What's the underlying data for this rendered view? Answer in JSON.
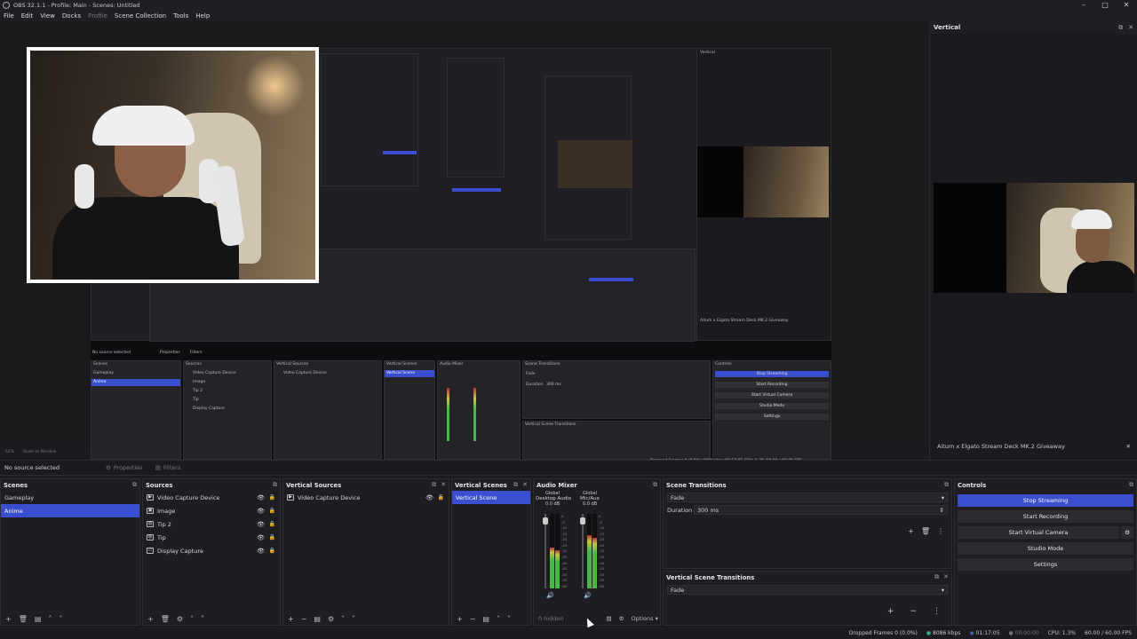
{
  "window": {
    "title": "OBS 32.1.1 - Profile: Main - Scenes: Untitled"
  },
  "menu": [
    "File",
    "Edit",
    "View",
    "Docks",
    "Profile",
    "Scene Collection",
    "Tools",
    "Help"
  ],
  "preview": {
    "nested": {
      "no_source": "No source selected",
      "properties": "Properties",
      "filters": "Filters",
      "scenes_title": "Scenes",
      "scenes": [
        "Gameplay",
        "Anime"
      ],
      "sources_title": "Sources",
      "sources": [
        "Video Capture Device",
        "Image",
        "Tip 2",
        "Tip",
        "Display Capture"
      ],
      "vsources_title": "Vertical Sources",
      "vsources": [
        "Video Capture Device"
      ],
      "vscenes_title": "Vertical Scenes",
      "vscenes": [
        "Vertical Scene"
      ],
      "mixer_title": "Audio Mixer",
      "transitions_title": "Scene Transitions",
      "transition": "Fade",
      "duration_label": "Duration",
      "duration": "300 ms",
      "vtransitions_title": "Vertical Scene Transitions",
      "controls_title": "Controls",
      "controls": [
        "Stop Streaming",
        "Start Recording",
        "Start Virtual Camera",
        "Studio Mode",
        "Settings"
      ],
      "vertical_title": "Vertical",
      "giveaway": "Aitum x Elgato Stream Deck MK.2 Giveaway",
      "status": "Dropped Frames 0 (0.0%)   8086 kbps   01:17:01   CPU: 1.3%   60.00 / 60.00 FPS"
    }
  },
  "zoom": {
    "value": "61%",
    "mode": "Scale to Window"
  },
  "vertical_dock": {
    "title": "Vertical",
    "giveaway": "Aitum x Elgato Stream Deck MK.2 Giveaway"
  },
  "props_bar": {
    "no_source": "No source selected",
    "properties": "Properties",
    "filters": "Filters"
  },
  "scenes": {
    "title": "Scenes",
    "items": [
      {
        "label": "Gameplay"
      },
      {
        "label": "Anime"
      }
    ]
  },
  "sources": {
    "title": "Sources",
    "items": [
      {
        "label": "Video Capture Device"
      },
      {
        "label": "Image"
      },
      {
        "label": "Tip 2"
      },
      {
        "label": "Tip"
      },
      {
        "label": "Display Capture"
      }
    ]
  },
  "vertical_sources": {
    "title": "Vertical Sources",
    "items": [
      {
        "label": "Video Capture Device"
      }
    ]
  },
  "vertical_scenes": {
    "title": "Vertical Scenes",
    "items": [
      {
        "label": "Vertical Scene"
      }
    ]
  },
  "audio_mixer": {
    "title": "Audio Mixer",
    "channels": [
      {
        "title": "Global",
        "name": "Desktop Audio",
        "db": "0.0 dB",
        "level": 0.55,
        "fader": 0.95
      },
      {
        "title": "Global",
        "name": "Mic/Aux",
        "db": "0.0 dB",
        "level": 0.72,
        "fader": 0.95
      }
    ],
    "ticks": [
      "0",
      "-5",
      "-10",
      "-15",
      "-20",
      "-25",
      "-30",
      "-35",
      "-40",
      "-45",
      "-50",
      "-55",
      "-60"
    ],
    "hidden": "0 hidden",
    "options": "Options"
  },
  "scene_transitions": {
    "title": "Scene Transitions",
    "transition": "Fade",
    "duration_label": "Duration",
    "duration": "300 ms"
  },
  "vertical_scene_transitions": {
    "title": "Vertical Scene Transitions",
    "transition": "Fade"
  },
  "controls": {
    "title": "Controls",
    "stop_streaming": "Stop Streaming",
    "start_recording": "Start Recording",
    "start_virtual_camera": "Start Virtual Camera",
    "studio_mode": "Studio Mode",
    "settings": "Settings"
  },
  "status": {
    "dropped": "Dropped Frames 0 (0.0%)",
    "bitrate": "8086 kbps",
    "stream_time": "01:17:05",
    "rec_time": "00:00:00",
    "cpu": "CPU: 1.3%",
    "fps": "60.00 / 60.00 FPS"
  },
  "colors": {
    "accent": "#3a4fd0",
    "meter_green": "#3fbf3f",
    "meter_yellow": "#c8c830",
    "meter_red": "#c03030"
  }
}
